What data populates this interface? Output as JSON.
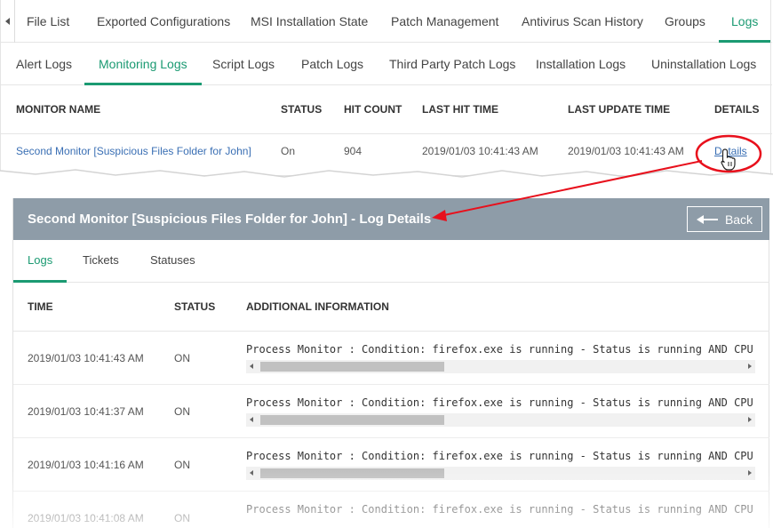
{
  "top_tabs": [
    {
      "label": "File List"
    },
    {
      "label": "Exported Configurations"
    },
    {
      "label": "MSI Installation State"
    },
    {
      "label": "Patch Management"
    },
    {
      "label": "Antivirus Scan History"
    },
    {
      "label": "Groups"
    },
    {
      "label": "Logs",
      "active": true
    }
  ],
  "sub_tabs": [
    {
      "label": "Alert Logs"
    },
    {
      "label": "Monitoring Logs",
      "active": true
    },
    {
      "label": "Script Logs"
    },
    {
      "label": "Patch Logs"
    },
    {
      "label": "Third Party Patch Logs"
    },
    {
      "label": "Installation Logs"
    },
    {
      "label": "Uninstallation Logs"
    }
  ],
  "monitor_table": {
    "headers": [
      "MONITOR NAME",
      "STATUS",
      "HIT COUNT",
      "LAST HIT TIME",
      "LAST UPDATE TIME",
      "DETAILS"
    ],
    "row": {
      "monitor_name": "Second Monitor [Suspicious Files Folder for John]",
      "status": "On",
      "hit_count": "904",
      "last_hit_time": "2019/01/03 10:41:43 AM",
      "last_update_time": "2019/01/03 10:41:43 AM",
      "details_link": "Details"
    }
  },
  "details_panel": {
    "title": "Second Monitor [Suspicious Files Folder for John] - Log Details",
    "back_label": "Back",
    "tabs": [
      {
        "label": "Logs",
        "active": true
      },
      {
        "label": "Tickets"
      },
      {
        "label": "Statuses"
      }
    ],
    "log_headers": [
      "TIME",
      "STATUS",
      "ADDITIONAL INFORMATION"
    ],
    "logs": [
      {
        "time": "2019/01/03 10:41:43 AM",
        "status": "ON",
        "info": "Process Monitor : Condition: firefox.exe is running - Status is running AND CPU"
      },
      {
        "time": "2019/01/03 10:41:37 AM",
        "status": "ON",
        "info": "Process Monitor : Condition: firefox.exe is running - Status is running AND CPU"
      },
      {
        "time": "2019/01/03 10:41:16 AM",
        "status": "ON",
        "info": "Process Monitor : Condition: firefox.exe is running - Status is running AND CPU"
      },
      {
        "time": "2019/01/03 10:41:08 AM",
        "status": "ON",
        "info": "Process Monitor : Condition: firefox.exe is running - Status is running AND CPU"
      }
    ]
  },
  "colors": {
    "accent": "#1b9a72",
    "link": "#3a6fb4",
    "panel_header": "#8e9ca8",
    "annotation": "#e8101c"
  },
  "icons": {
    "tab_scroll": "chevron-left-icon",
    "back": "arrow-left-icon",
    "cursor": "hand-pointer-icon"
  }
}
